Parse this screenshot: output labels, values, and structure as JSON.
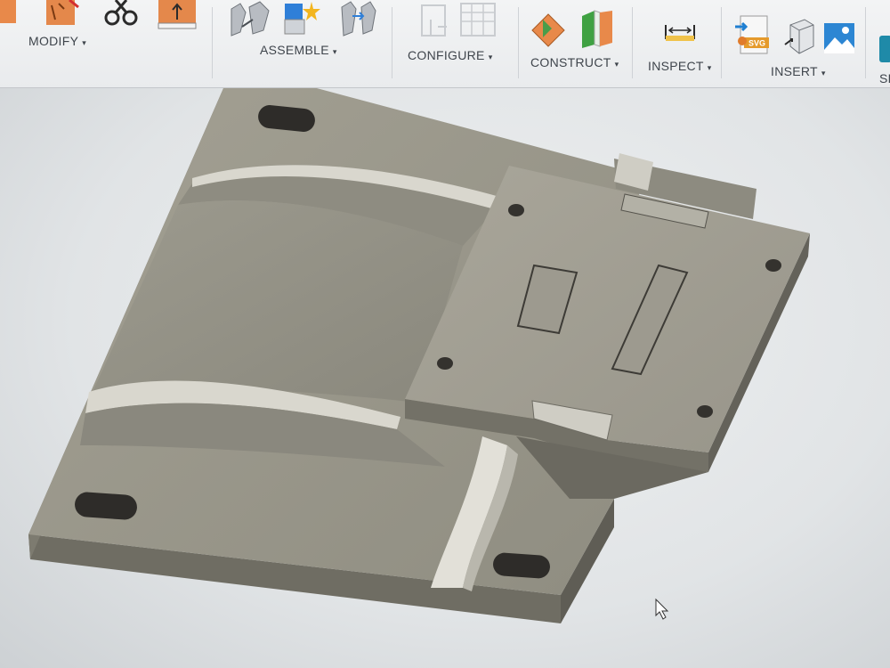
{
  "toolbar": {
    "groups": [
      {
        "id": "modify",
        "label": "MODIFY"
      },
      {
        "id": "assemble",
        "label": "ASSEMBLE"
      },
      {
        "id": "configure",
        "label": "CONFIGURE"
      },
      {
        "id": "construct",
        "label": "CONSTRUCT"
      },
      {
        "id": "inspect",
        "label": "INSPECT"
      },
      {
        "id": "insert",
        "label": "INSERT"
      },
      {
        "id": "select",
        "label": "SE"
      }
    ],
    "caret": "▾",
    "insert_svg_badge": "SVG"
  },
  "icons": {
    "modify": [
      "press-pull-icon",
      "fillet-icon",
      "scissors-icon",
      "align-icon"
    ],
    "assemble": [
      "new-component-icon",
      "joint-icon",
      "motion-link-icon"
    ],
    "configure": [
      "configure-table-icon",
      "configure-disabled-icon"
    ],
    "construct": [
      "offset-plane-icon",
      "midplane-icon"
    ],
    "inspect": [
      "measure-icon"
    ],
    "insert": [
      "insert-svg-icon",
      "insert-mesh-icon",
      "insert-canvas-icon"
    ]
  },
  "colors": {
    "accent_orange": "#e07b2a",
    "accent_blue": "#1f7fd1",
    "model_top": "#9a978a",
    "model_side": "#76746a"
  }
}
